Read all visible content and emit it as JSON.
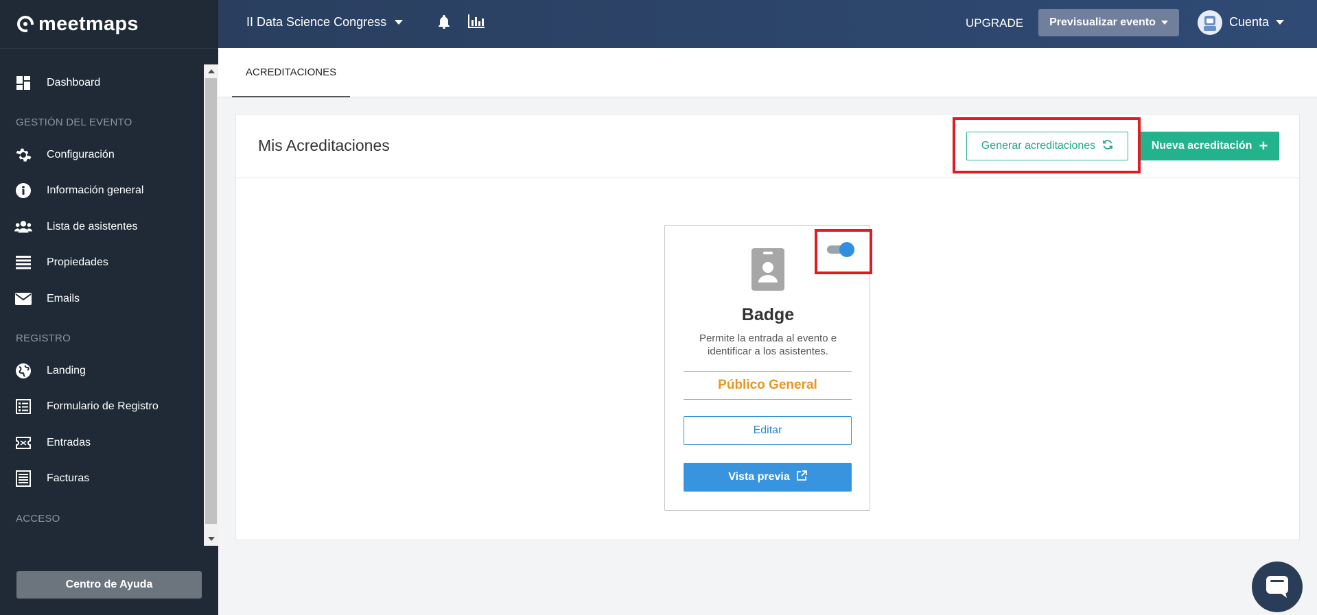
{
  "brand": {
    "name": "meetmaps"
  },
  "topbar": {
    "event_name": "II Data Science Congress",
    "upgrade_label": "UPGRADE",
    "preview_label": "Previsualizar evento",
    "account_label": "Cuenta"
  },
  "sidebar": {
    "items": [
      {
        "label": "Dashboard",
        "icon": "dashboard-icon"
      },
      {
        "section": "GESTIÓN DEL EVENTO"
      },
      {
        "label": "Configuración",
        "icon": "gear-icon"
      },
      {
        "label": "Información general",
        "icon": "info-icon"
      },
      {
        "label": "Lista de asistentes",
        "icon": "users-icon"
      },
      {
        "label": "Propiedades",
        "icon": "list-icon"
      },
      {
        "label": "Emails",
        "icon": "envelope-icon"
      },
      {
        "section": "REGISTRO"
      },
      {
        "label": "Landing",
        "icon": "globe-icon"
      },
      {
        "label": "Formulario de Registro",
        "icon": "form-icon"
      },
      {
        "label": "Entradas",
        "icon": "ticket-icon"
      },
      {
        "label": "Facturas",
        "icon": "receipt-icon"
      },
      {
        "section": "ACCESO"
      }
    ],
    "help_label": "Centro de Ayuda"
  },
  "tabs": [
    {
      "label": "ACREDITACIONES",
      "active": true
    }
  ],
  "panel": {
    "title": "Mis Acreditaciones",
    "generate_label": "Generar acreditaciones",
    "new_label": "Nueva acreditación"
  },
  "card": {
    "title": "Badge",
    "description": "Permite la entrada al evento e identificar a los asistentes.",
    "audience": "Público General",
    "edit_label": "Editar",
    "preview_label": "Vista previa",
    "enabled": true
  },
  "colors": {
    "sidebar_bg": "#1f2a36",
    "topbar_bg": "#2f4a74",
    "accent_green": "#22b38d",
    "accent_blue": "#3894de",
    "accent_orange": "#e8961f",
    "highlight_red": "#e01b24"
  }
}
